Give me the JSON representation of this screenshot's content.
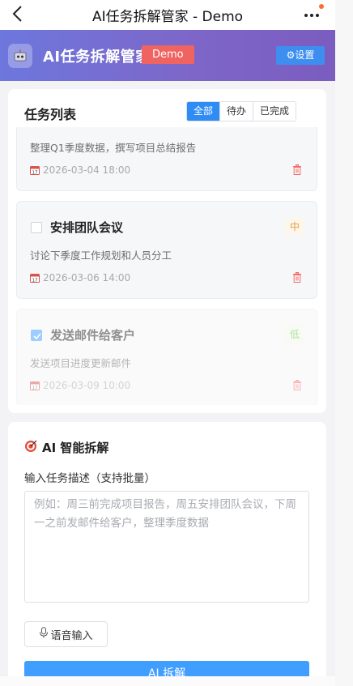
{
  "navbar": {
    "title": "AI任务拆解管家 - Demo",
    "back_icon": "chevron-left-icon",
    "more_icon": "more-dots-icon",
    "notification_dot_color": "#ff6b2c"
  },
  "header": {
    "title": "AI任务拆解管家",
    "badge": "Demo",
    "settings_label": "⚙设置",
    "logo_icon": "robot-icon",
    "gradient_colors": [
      "#6d77dd",
      "#7b5cbf"
    ]
  },
  "task_list": {
    "title": "任务列表",
    "filters": [
      {
        "label": "全部",
        "active": true
      },
      {
        "label": "待办",
        "active": false
      },
      {
        "label": "已完成",
        "active": false
      }
    ],
    "items": [
      {
        "name": "",
        "description": "整理Q1季度数据，撰写项目总结报告",
        "due": "2026-03-04 18:00",
        "priority": "",
        "completed": false
      },
      {
        "name": "安排团队会议",
        "description": "讨论下季度工作规划和人员分工",
        "due": "2026-03-06 14:00",
        "priority": "中",
        "completed": false
      },
      {
        "name": "发送邮件给客户",
        "description": "发送项目进度更新邮件",
        "due": "2026-03-09 10:00",
        "priority": "低",
        "completed": true
      }
    ]
  },
  "ai_panel": {
    "title": "AI 智能拆解",
    "title_icon": "target-icon",
    "input_label": "输入任务描述（支持批量）",
    "input_value": "",
    "input_placeholder": "例如：周三前完成项目报告，周五安排团队会议，下周一之前发邮件给客户，整理季度数据",
    "voice_label": "语音输入",
    "voice_icon": "microphone-icon",
    "submit_label": "AI 拆解"
  },
  "colors": {
    "primary": "#409eff",
    "danger": "#ef6361",
    "priority_mid": "#e6a23c",
    "priority_low": "#67c23a"
  }
}
